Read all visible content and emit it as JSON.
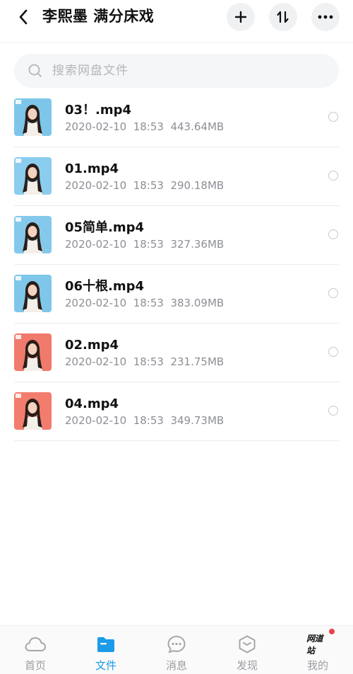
{
  "header": {
    "title": "李熙墨 满分床戏"
  },
  "search": {
    "placeholder": "搜索网盘文件"
  },
  "files": [
    {
      "name": "03！.mp4",
      "date": "2020-02-10",
      "time": "18:53",
      "size": "443.64MB",
      "thumb_bg": "#7dc6ea"
    },
    {
      "name": "01.mp4",
      "date": "2020-02-10",
      "time": "18:53",
      "size": "290.18MB",
      "thumb_bg": "#8acdee"
    },
    {
      "name": "05简单.mp4",
      "date": "2020-02-10",
      "time": "18:53",
      "size": "327.36MB",
      "thumb_bg": "#84c9ec"
    },
    {
      "name": "06十根.mp4",
      "date": "2020-02-10",
      "time": "18:53",
      "size": "383.09MB",
      "thumb_bg": "#7ec7ea"
    },
    {
      "name": "02.mp4",
      "date": "2020-02-10",
      "time": "18:53",
      "size": "231.75MB",
      "thumb_bg": "#f07a6c"
    },
    {
      "name": "04.mp4",
      "date": "2020-02-10",
      "time": "18:53",
      "size": "349.73MB",
      "thumb_bg": "#f27c6e"
    }
  ],
  "tabbar": {
    "tabs": [
      {
        "label": "首页",
        "icon": "cloud-icon"
      },
      {
        "label": "文件",
        "icon": "folder-icon",
        "active": true
      },
      {
        "label": "消息",
        "icon": "chat-bubble-icon"
      },
      {
        "label": "发现",
        "icon": "discover-box-icon"
      },
      {
        "label": "我的",
        "icon": "brand-logo-icon",
        "logo_text": "网道站"
      }
    ]
  },
  "colors": {
    "accent": "#1b9be8",
    "notify": "#e8434a",
    "meta_text": "#8c8f95"
  }
}
